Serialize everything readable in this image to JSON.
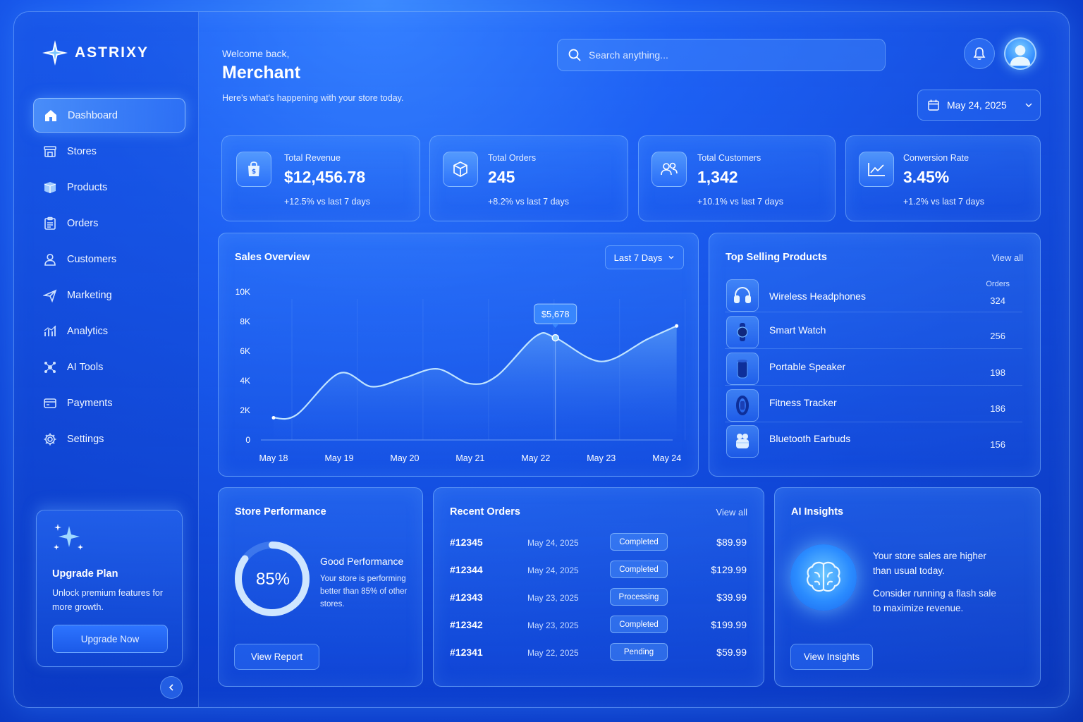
{
  "brand": {
    "name": "ASTRIXY"
  },
  "sidebar": {
    "items": [
      {
        "label": "Dashboard",
        "icon": "home-icon",
        "active": true
      },
      {
        "label": "Stores",
        "icon": "store-icon"
      },
      {
        "label": "Products",
        "icon": "box-icon"
      },
      {
        "label": "Orders",
        "icon": "clipboard-icon"
      },
      {
        "label": "Customers",
        "icon": "user-icon"
      },
      {
        "label": "Marketing",
        "icon": "megaphone-icon"
      },
      {
        "label": "Analytics",
        "icon": "analytics-icon"
      },
      {
        "label": "AI Tools",
        "icon": "ai-tools-icon"
      },
      {
        "label": "Payments",
        "icon": "card-icon"
      },
      {
        "label": "Settings",
        "icon": "gear-icon"
      }
    ],
    "upgrade": {
      "title": "Upgrade Plan",
      "desc": "Unlock premium features for more growth.",
      "button": "Upgrade Now"
    }
  },
  "header": {
    "welcome": "Welcome back,",
    "name": "Merchant",
    "subtitle": "Here's what's happening with your store today.",
    "search_placeholder": "Search anything...",
    "date": "May 24, 2025"
  },
  "stats": [
    {
      "label": "Total Revenue",
      "value": "$12,456.78",
      "change": "+12.5% vs last 7 days",
      "icon": "shopping-bag-icon"
    },
    {
      "label": "Total Orders",
      "value": "245",
      "change": "+8.2% vs last 7 days",
      "icon": "cube-icon"
    },
    {
      "label": "Total Customers",
      "value": "1,342",
      "change": "+10.1% vs last 7 days",
      "icon": "users-icon"
    },
    {
      "label": "Conversion Rate",
      "value": "3.45%",
      "change": "+1.2% vs last 7 days",
      "icon": "trend-icon"
    }
  ],
  "sales": {
    "title": "Sales Overview",
    "range": "Last 7 Days",
    "tooltip": "$5,678"
  },
  "chart_data": {
    "type": "line",
    "title": "Sales Overview",
    "categories": [
      "May 18",
      "May 19",
      "May 20",
      "May 21",
      "May 22",
      "May 23",
      "May 24"
    ],
    "y_ticks": [
      "0",
      "2K",
      "4K",
      "6K",
      "8K",
      "10K"
    ],
    "ylim": [
      0,
      10000
    ],
    "x": [
      0,
      0.35,
      1,
      1.5,
      2,
      2.5,
      3,
      3.4,
      4,
      4.3,
      5,
      5.7,
      6.15
    ],
    "y": [
      1500,
      1700,
      4500,
      3600,
      4200,
      4800,
      3800,
      4300,
      7000,
      6900,
      5300,
      6800,
      7700
    ],
    "highlight": {
      "x": 4.3,
      "y": 6900,
      "label": "$5,678"
    },
    "grid": true,
    "color": "#bfe3ff"
  },
  "top_products": {
    "title": "Top Selling Products",
    "view_all": "View all",
    "orders_header": "Orders",
    "items": [
      {
        "name": "Wireless Headphones",
        "orders": "324",
        "icon": "headphones-icon"
      },
      {
        "name": "Smart Watch",
        "orders": "256",
        "icon": "watch-icon"
      },
      {
        "name": "Portable Speaker",
        "orders": "198",
        "icon": "speaker-icon"
      },
      {
        "name": "Fitness Tracker",
        "orders": "186",
        "icon": "fitness-tracker-icon"
      },
      {
        "name": "Bluetooth Earbuds",
        "orders": "156",
        "icon": "earbuds-icon"
      }
    ]
  },
  "performance": {
    "title": "Store Performance",
    "percent_label": "85%",
    "percent": 0.85,
    "heading": "Good Performance",
    "desc": "Your store is performing better than 85% of other stores.",
    "button": "View Report"
  },
  "orders": {
    "title": "Recent Orders",
    "view_all": "View all",
    "rows": [
      {
        "id": "#12345",
        "date": "May 24, 2025",
        "status": "Completed",
        "amount": "$89.99"
      },
      {
        "id": "#12344",
        "date": "May 24, 2025",
        "status": "Completed",
        "amount": "$129.99"
      },
      {
        "id": "#12343",
        "date": "May 23, 2025",
        "status": "Processing",
        "amount": "$39.99"
      },
      {
        "id": "#12342",
        "date": "May 23, 2025",
        "status": "Completed",
        "amount": "$199.99"
      },
      {
        "id": "#12341",
        "date": "May 22, 2025",
        "status": "Pending",
        "amount": "$59.99"
      }
    ]
  },
  "ai": {
    "title": "AI Insights",
    "line1": "Your store sales are higher than usual today.",
    "line2": "Consider running a flash sale to maximize revenue.",
    "button": "View Insights"
  }
}
